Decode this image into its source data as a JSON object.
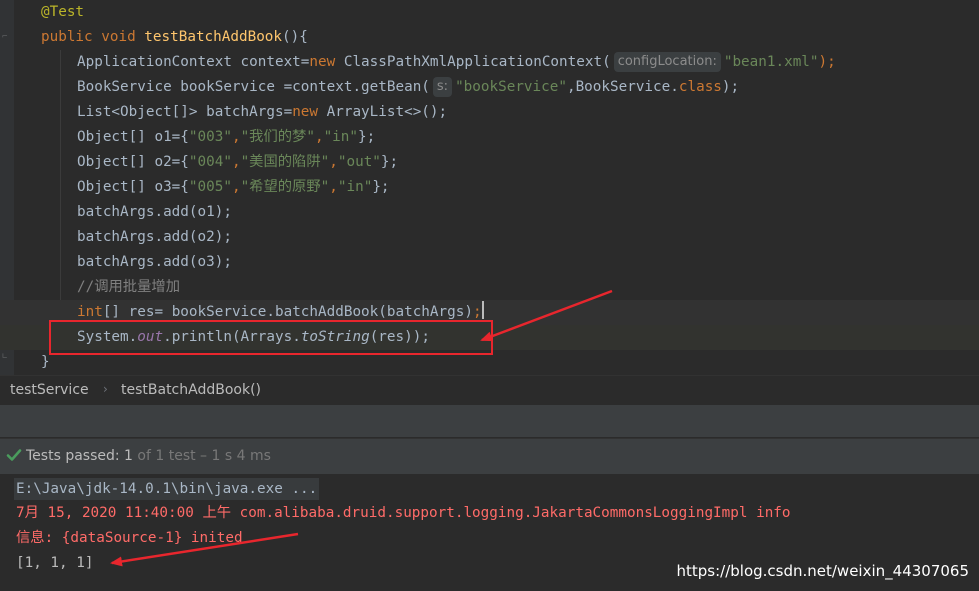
{
  "editor": {
    "annotation": "@Test",
    "method_modifiers": "public void ",
    "method_name": "testBatchAddBook",
    "method_tail": "(){",
    "l3_pre": "ApplicationContext context=",
    "l3_new": "new",
    "l3_class": " ClassPathXmlApplicationContext(",
    "l3_hint": "configLocation:",
    "l3_str": "\"bean1.xml\"",
    "l3_end": ");",
    "l4_pre": "BookService bookService =context.getBean(",
    "l4_hint": "s:",
    "l4_str": "\"bookService\"",
    "l4_mid": ",BookService.",
    "l4_kw": "class",
    "l4_end": ");",
    "l5_pre": "List<Object[]> batchArgs=",
    "l5_new": "new",
    "l5_end": " ArrayList<>();",
    "o1_pre": "Object[] o1={",
    "o1_s1": "\"003\"",
    "o1_s2": "\"我们的梦\"",
    "o1_s3": "\"in\"",
    "o2_pre": "Object[] o2={",
    "o2_s1": "\"004\"",
    "o2_s2": "\"美国的陷阱\"",
    "o2_s3": "\"out\"",
    "o3_pre": "Object[] o3={",
    "o3_s1": "\"005\"",
    "o3_s2": "\"希望的原野\"",
    "o3_s3": "\"in\"",
    "comma": ",",
    "arr_end": "};",
    "add1": "batchArgs.add(o1);",
    "add2": "batchArgs.add(o2);",
    "add3": "batchArgs.add(o3);",
    "comment": "//调用批量增加",
    "l13_kw": "int",
    "l13_rest": "[] res= bookService.batchAddBook(batchArgs)",
    "l13_end": ";",
    "l14_pre": "System.",
    "l14_field": "out",
    "l14_mid": ".println(Arrays.",
    "l14_fn": "toString",
    "l14_end": "(res));",
    "closing_brace": "}"
  },
  "breadcrumb": {
    "class_name": "testService",
    "separator": "›",
    "method_name": "testBatchAddBook()"
  },
  "status": {
    "label": "Tests passed: ",
    "count": "1",
    "detail": " of 1 test – 1 s 4 ms"
  },
  "console": {
    "command": "E:\\Java\\jdk-14.0.1\\bin\\java.exe ...",
    "log_line1": "7月 15, 2020 11:40:00 上午 com.alibaba.druid.support.logging.JakartaCommonsLoggingImpl info",
    "log_line2": "信息: {dataSource-1} inited",
    "output": "[1, 1, 1]"
  },
  "watermark": "https://blog.csdn.net/weixin_44307065",
  "colors": {
    "keyword": "#cc7832",
    "string": "#6a8759",
    "annotation": "#bbb529",
    "method": "#ffc66d",
    "field": "#9876aa",
    "error_text": "#ff6b68",
    "pass_check": "#4a9c5d",
    "annotation_red": "#e8262d"
  },
  "icons": [
    "fold-icon",
    "check-icon",
    "arrow-annotation"
  ]
}
